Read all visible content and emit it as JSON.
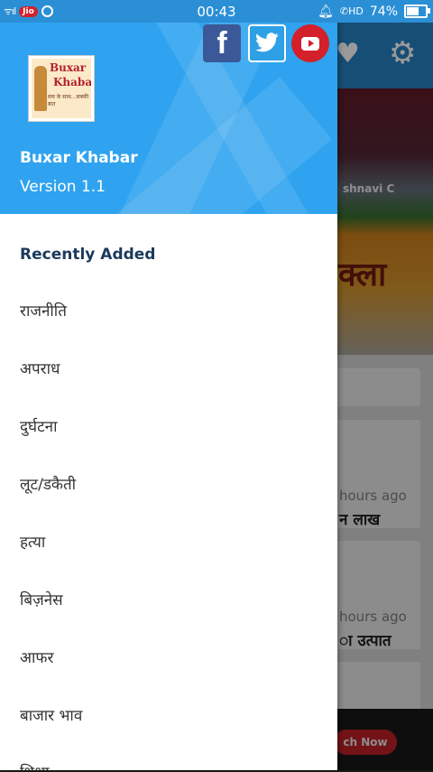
{
  "status_bar": {
    "signal": "ᯤıl",
    "carrier_badge": "Jio",
    "time": "00:43",
    "call_indicator": "HD",
    "battery": "74%",
    "battery_level": 0.74
  },
  "drawer": {
    "app_name": "Buxar Khabar",
    "version": "Version 1.1",
    "logo": {
      "line1": "Buxar",
      "line2": "Khabar",
      "tagline": "सच के साथ...सबकी बात"
    },
    "social": {
      "facebook": "f"
    },
    "section_header": "Recently Added",
    "menu_items": [
      "राजनीति",
      "अपराध",
      "दुर्घटना",
      "लूट/डकैती",
      "हत्या",
      "बिज़नेस",
      "आफर",
      "बाजार भाव",
      "शिक्षा"
    ]
  },
  "background": {
    "banner_partial": "क्ला",
    "sign_partial": "shnavi C",
    "news": [
      {
        "time": "hours ago",
        "title": "न लाख"
      },
      {
        "time": "hours ago",
        "title": "ा उत्पात"
      }
    ],
    "ad_button": "ch Now"
  },
  "colors": {
    "status_bar": "#2b8fd6",
    "drawer_header": "#2fa3ef",
    "section_header": "#1b3a5c",
    "facebook": "#3b5998",
    "twitter": "#2ea0e6",
    "youtube": "#d3202a"
  }
}
